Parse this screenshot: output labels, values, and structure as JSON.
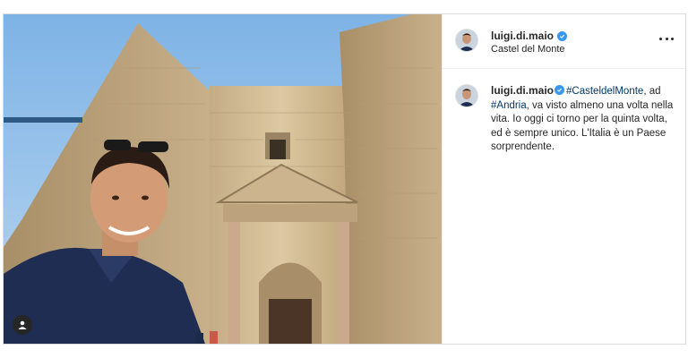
{
  "post": {
    "username": "luigi.di.maio",
    "location": "Castel del Monte",
    "caption": {
      "username": "luigi.di.maio",
      "hashtag1": "#CasteldelMonte",
      "text1": ", ad ",
      "hashtag2": "#Andria",
      "text2": ", va visto almeno una volta nella vita. Io oggi ci torno per la quinta volta, ed è sempre unico. L'Italia è un Paese sorprendente."
    }
  },
  "icons": {
    "verified": "verified-badge-icon",
    "more": "more-options-icon",
    "tagged_user": "user-tag-icon"
  },
  "colors": {
    "verified": "#3897f0",
    "hashtag": "#00376b",
    "text": "#262626",
    "border": "#dbdbdb"
  }
}
